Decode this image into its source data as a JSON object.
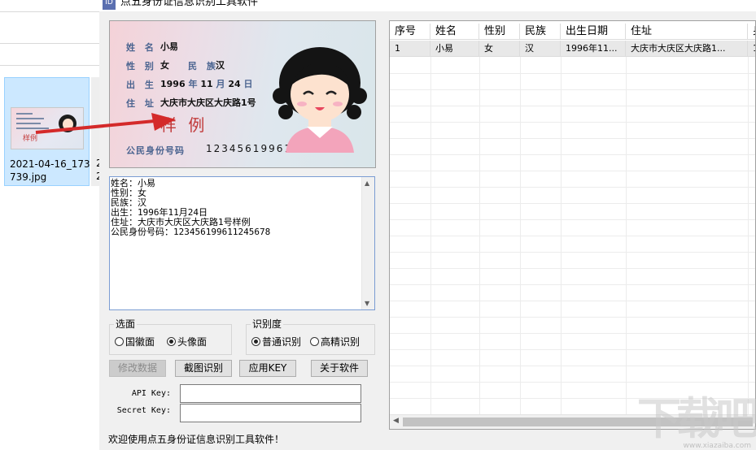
{
  "explorer": {
    "thumbnail_label": "2021-04-16_173739.jpg",
    "thumbnail_label_line1": "2021-04-16_173",
    "thumbnail_label_line2": "739.jpg",
    "thumbnail_preview_watermark": "样例",
    "second_item_label_line1": "2",
    "second_item_label_line2": "2"
  },
  "window": {
    "title": "点五身份证信息识别工具软件",
    "icon_text": "ID"
  },
  "card": {
    "name_label": "姓 名",
    "name_value": "小易",
    "gender_label": "性 别",
    "gender_value": "女",
    "ethnic_label": "民 族",
    "ethnic_value": "汉",
    "birth_label": "出 生",
    "birth_year": "1996",
    "year_char": "年",
    "birth_month": "11",
    "month_char": "月",
    "birth_day": "24",
    "day_char": "日",
    "address_label": "住 址",
    "address_value": "大庆市大庆区大庆路1号",
    "watermark": "样 例",
    "idnum_label": "公民身份号码",
    "idnum_value": "123456199611245678"
  },
  "ocr_result": {
    "lines": [
      "姓名：小易",
      "性别：女",
      "民族：汉",
      "出生：1996年11月24日",
      "住址：大庆市大庆区大庆路1号样例",
      "公民身份号码：123456199611245678"
    ]
  },
  "side_group": {
    "title": "选面",
    "option_national": "国徽面",
    "option_portrait": "头像面",
    "selected": "头像面"
  },
  "accuracy_group": {
    "title": "识别度",
    "option_normal": "普通识别",
    "option_high": "高精识别",
    "selected": "普通识别"
  },
  "buttons": {
    "modify": "修改数据",
    "screenshot": "截图识别",
    "apply_key": "应用KEY",
    "about": "关于软件"
  },
  "keys": {
    "api_label": "API Key:",
    "api_value": "",
    "secret_label": "Secret Key:",
    "secret_value": ""
  },
  "status": "欢迎使用点五身份证信息识别工具软件！",
  "table": {
    "columns": [
      "序号",
      "姓名",
      "性别",
      "民族",
      "出生日期",
      "住址",
      "身"
    ],
    "rows": [
      [
        "1",
        "小易",
        "女",
        "汉",
        "1996年11...",
        "大庆市大庆区大庆路1...",
        "1"
      ]
    ]
  },
  "site_watermark": {
    "text": "下载吧",
    "url": "www.xiazaiba.com"
  },
  "colors": {
    "window_bg": "#f0f0f0",
    "selection_blue": "#cce8ff",
    "card_label_blue": "#4b6490",
    "card_watermark_red": "#c13a3a",
    "arrow_red": "#d42a2a"
  }
}
